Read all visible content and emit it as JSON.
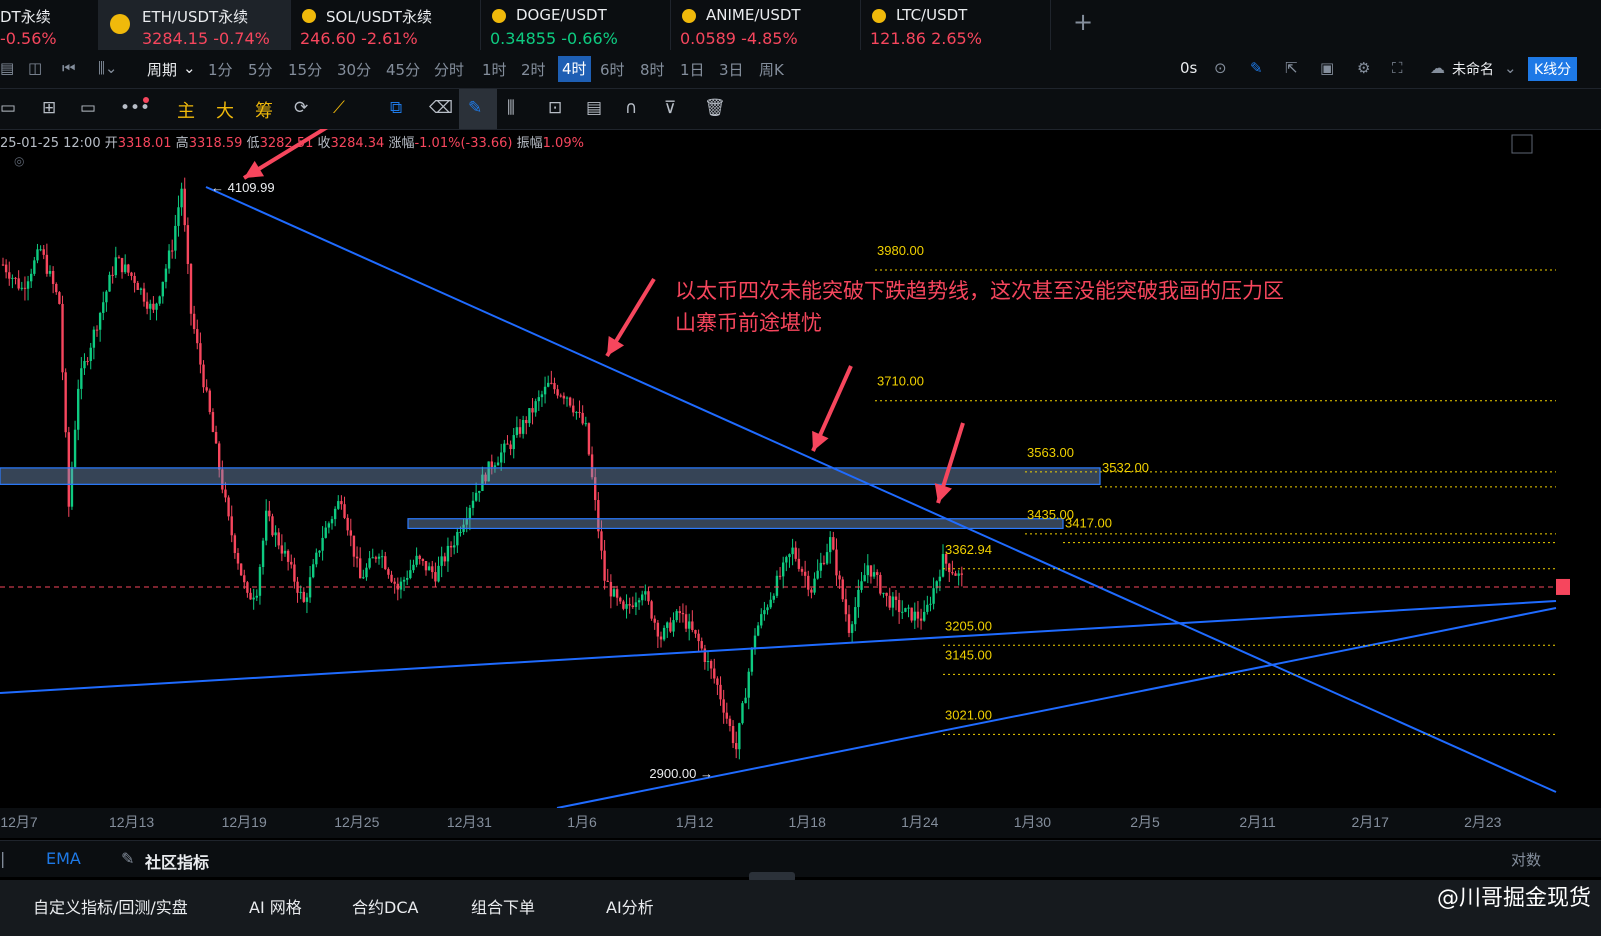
{
  "tabs": [
    {
      "name": "DT永续",
      "price": "-0.56%",
      "dir": "dn",
      "icon": false
    },
    {
      "name": "ETH/USDT永续",
      "price": "3284.15  -0.74%",
      "dir": "dn",
      "icon": true,
      "active": true
    },
    {
      "name": "SOL/USDT永续",
      "price": "246.60  -2.61%",
      "dir": "dn",
      "icon": true
    },
    {
      "name": "DOGE/USDT",
      "price": "0.34855  -0.66%",
      "dir": "up",
      "icon": true
    },
    {
      "name": "ANIME/USDT",
      "price": "0.0589  -4.85%",
      "dir": "dn",
      "icon": true
    },
    {
      "name": "LTC/USDT",
      "price": "121.86  2.65%",
      "dir": "dn",
      "icon": true
    }
  ],
  "toolbar": {
    "period_label": "周期",
    "intervals": [
      "1分",
      "5分",
      "15分",
      "30分",
      "45分",
      "分时",
      "1时",
      "2时",
      "4时",
      "6时",
      "8时",
      "1日",
      "3日",
      "周K"
    ],
    "selected": "4时",
    "countdown": "0s",
    "layout_name": "未命名",
    "kline_button": "K线分",
    "tools_cn": [
      "主",
      "大",
      "筹"
    ]
  },
  "ohlc": {
    "date": "25-01-25 12:00",
    "open_l": "开",
    "open": "3318.01",
    "high_l": "高",
    "high": "3318.59",
    "low_l": "低",
    "low": "3282.51",
    "close_l": "收",
    "close": "3284.34",
    "chg_l": "涨幅",
    "chg": "-1.01%(-33.66)",
    "amp_l": "振幅",
    "amp": "1.09%"
  },
  "annotation": {
    "line1": "以太币四次未能突破下跌趋势线，这次甚至没能突破我画的压力区",
    "line2": "山寨币前途堪忧"
  },
  "chart_data": {
    "type": "candlestick",
    "x_ticks": [
      "12月7",
      "12月13",
      "12月19",
      "12月25",
      "12月31",
      "1月6",
      "1月12",
      "1月18",
      "1月24",
      "1月30",
      "2月5",
      "2月11",
      "2月17",
      "2月23"
    ],
    "high_marker": {
      "label": "← 4109.99",
      "value": 4109.99,
      "x": "12月16"
    },
    "low_marker": {
      "label": "2900.00 →",
      "value": 2900.0,
      "x": "1月13"
    },
    "current_price": 3284.15,
    "level_labels": [
      {
        "label": "3980.00",
        "value": 3980.0
      },
      {
        "label": "3710.00",
        "value": 3710.0
      },
      {
        "label": "3563.00",
        "value": 3563.0
      },
      {
        "label": "3532.00",
        "value": 3532.0
      },
      {
        "label": "3435.00",
        "value": 3435.0
      },
      {
        "label": "3417.00",
        "value": 3417.0
      },
      {
        "label": "3362.94",
        "value": 3362.94
      },
      {
        "label": "3205.00",
        "value": 3205.0
      },
      {
        "label": "3145.00",
        "value": 3145.0
      },
      {
        "label": "3021.00",
        "value": 3021.0
      }
    ],
    "resistance_zones": [
      [
        3496,
        3530
      ],
      [
        3405,
        3425
      ]
    ],
    "colors": {
      "up": "#0ecb81",
      "down": "#f6465d",
      "trend": "#1f6bff",
      "level": "#f0d000"
    }
  },
  "bottom": {
    "ema": "EMA",
    "community": "社区指标",
    "log": "对数",
    "menu": [
      "自定义指标/回测/实盘",
      "AI 网格",
      "合约DCA",
      "组合下单",
      "AI分析"
    ],
    "watermark": "@川哥掘金现货"
  }
}
